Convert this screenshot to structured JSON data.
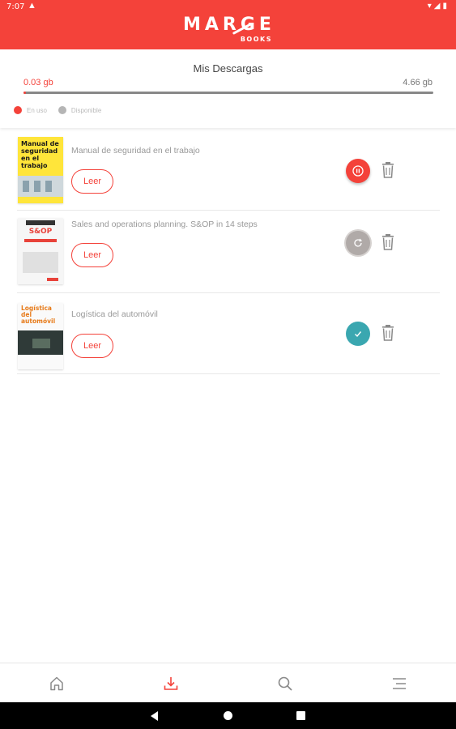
{
  "status_bar": {
    "time": "7:07",
    "warning": "▲",
    "right_icons": "▾◢▮"
  },
  "app": {
    "brand": "MARGE",
    "brand_sub": "BOOKS"
  },
  "storage": {
    "title": "Mis Descargas",
    "used_label": "0.03 gb",
    "available_label": "4.66 gb",
    "used_fraction": 0.006,
    "legend": [
      {
        "label": "En uso",
        "color": "#f4423a"
      },
      {
        "label": "Disponible",
        "color": "#b5b5b5"
      }
    ]
  },
  "books": [
    {
      "title": "Manual de seguridad en el trabajo",
      "cover_title": "Manual de seguridad en el trabajo",
      "read_label": "Leer",
      "status": "downloading",
      "status_icon": "pause-icon"
    },
    {
      "title": "Sales and operations planning. S&OP in 14 steps",
      "cover_title": "S&OP",
      "read_label": "Leer",
      "status": "pending",
      "status_icon": "refresh-icon"
    },
    {
      "title": "Logística del automóvil",
      "cover_title": "Logística del automóvil",
      "read_label": "Leer",
      "status": "downloaded",
      "status_icon": "check-icon"
    }
  ],
  "bottom_nav": [
    {
      "name": "home",
      "icon": "home-icon",
      "active": false
    },
    {
      "name": "downloads",
      "icon": "download-icon",
      "active": true
    },
    {
      "name": "search",
      "icon": "search-icon",
      "active": false
    },
    {
      "name": "menu",
      "icon": "menu-icon",
      "active": false
    }
  ],
  "colors": {
    "accent": "#f4423a",
    "pending": "#b0aaa8",
    "done": "#3aa7b0",
    "inactive_icon": "#8a8a8a"
  }
}
